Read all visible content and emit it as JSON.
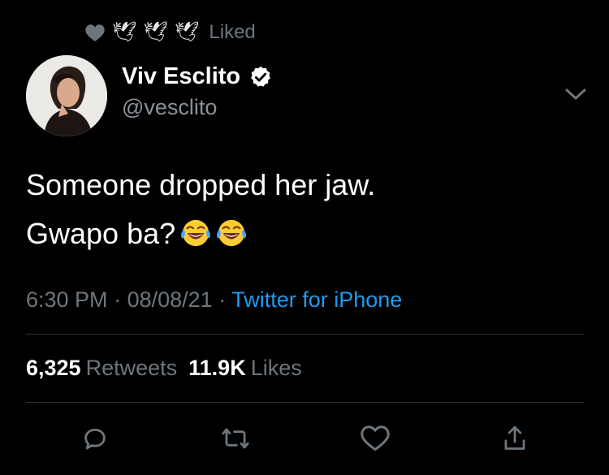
{
  "social_context": {
    "icons": [
      "heart-icon",
      "dove-icon",
      "dove-icon",
      "dove-icon"
    ],
    "label": "Liked"
  },
  "author": {
    "display_name": "Viv Esclito",
    "handle": "@vesclito",
    "verified": true
  },
  "tweet": {
    "lines": [
      "Someone dropped her jaw.",
      "Gwapo ba?"
    ],
    "emojis": [
      "face-with-tears-of-joy",
      "face-with-tears-of-joy"
    ]
  },
  "meta": {
    "time": "6:30 PM",
    "separator": "·",
    "date": "08/08/21",
    "source": "Twitter for iPhone"
  },
  "stats": {
    "retweets_count": "6,325",
    "retweets_label": "Retweets",
    "likes_count": "11.9K",
    "likes_label": "Likes"
  },
  "actions": [
    "reply-icon",
    "retweet-icon",
    "like-icon",
    "share-icon"
  ],
  "colors": {
    "background": "#000000",
    "text": "#ffffff",
    "secondary": "#6e767d",
    "accent": "#1d9bf0",
    "divider": "#2f3336"
  }
}
